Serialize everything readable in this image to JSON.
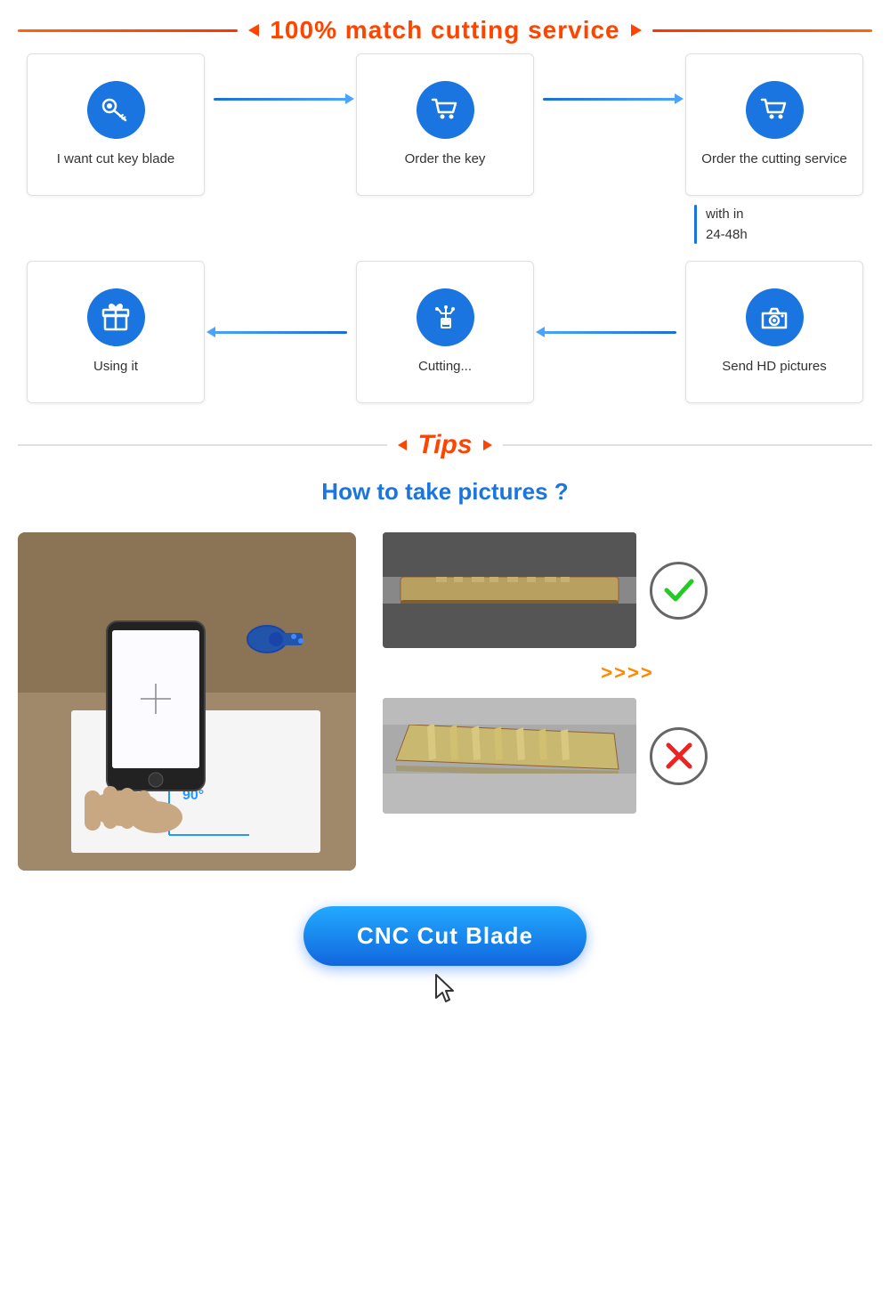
{
  "header": {
    "title": "100% match cutting service"
  },
  "steps": {
    "row1": [
      {
        "id": "step1",
        "label": "I want cut key blade",
        "icon": "keys"
      },
      {
        "id": "step2",
        "label": "Order the key",
        "icon": "cart"
      },
      {
        "id": "step3",
        "label": "Order the cutting service",
        "icon": "cart2"
      }
    ],
    "row2": [
      {
        "id": "step4",
        "label": "Using it",
        "icon": "gift"
      },
      {
        "id": "step5",
        "label": "Cutting...",
        "icon": "machine"
      },
      {
        "id": "step6",
        "label": "Send HD pictures",
        "icon": "camera"
      }
    ],
    "within": {
      "line1": "with in",
      "line2": "24-48h"
    }
  },
  "tips": {
    "title": "Tips",
    "subtitle": "How to take pictures ?"
  },
  "photos": {
    "left_alt": "Person taking photo of key at 90 degree angle",
    "right_good_alt": "Good key photo - clear horizontal view",
    "right_bad_alt": "Bad key photo - angled view",
    "arrows": ">>>>"
  },
  "cnc_button": {
    "label": "CNC Cut Blade"
  }
}
